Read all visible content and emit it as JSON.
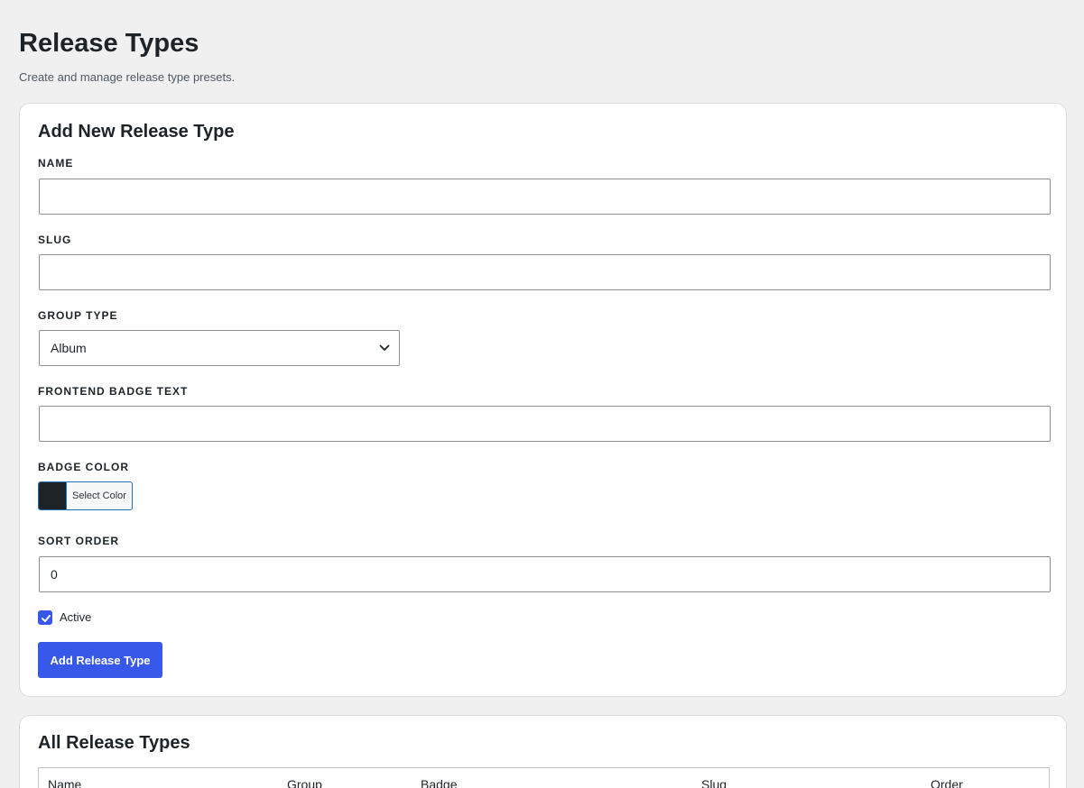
{
  "header": {
    "title": "Release Types",
    "subtitle": "Create and manage release type presets."
  },
  "add_form": {
    "title": "Add New Release Type",
    "name": {
      "label": "NAME",
      "value": ""
    },
    "slug": {
      "label": "SLUG",
      "value": ""
    },
    "group_type": {
      "label": "GROUP TYPE",
      "selected": "Album"
    },
    "badge_text": {
      "label": "FRONTEND BADGE TEXT",
      "value": ""
    },
    "badge_color": {
      "label": "BADGE COLOR",
      "button_label": "Select Color",
      "value": "#1d2327"
    },
    "sort_order": {
      "label": "SORT ORDER",
      "value": "0"
    },
    "active": {
      "label": "Active",
      "checked": true
    },
    "submit_label": "Add Release Type"
  },
  "list": {
    "title": "All Release Types",
    "columns": [
      "Name",
      "Group",
      "Badge",
      "Slug",
      "Order"
    ]
  },
  "colors": {
    "accent": "#3858e9",
    "page_bg": "#f0f0f1",
    "badge_swatch": "#1d2327"
  }
}
